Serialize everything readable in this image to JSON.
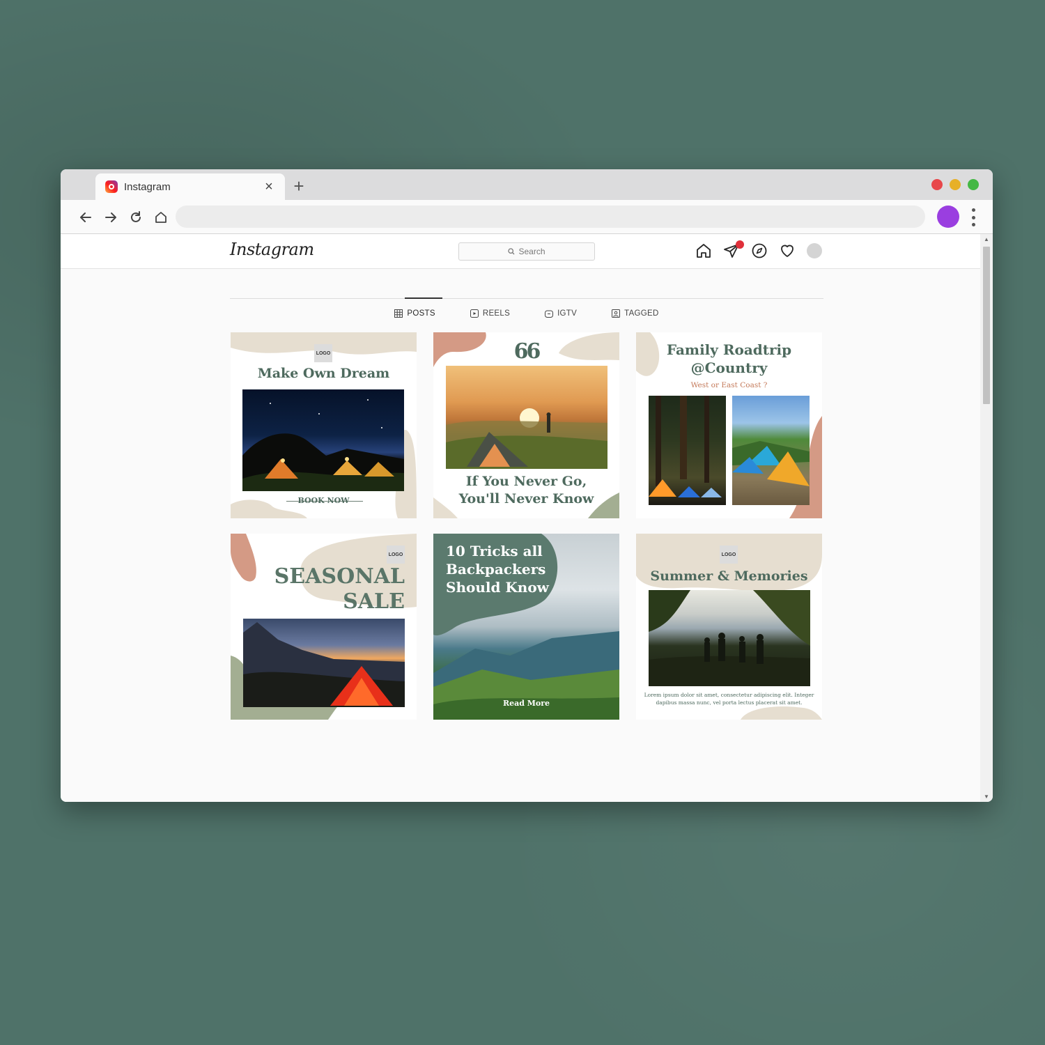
{
  "browser": {
    "tab_title": "Instagram",
    "close_glyph": "×",
    "newtab_glyph": "+",
    "traffic_lights": [
      "#e8474a",
      "#e7b027",
      "#44b844"
    ],
    "profile_color": "#9a3ee0"
  },
  "instagram": {
    "logo": "Instagram",
    "search_placeholder": "Search",
    "nav_icons": [
      "home-icon",
      "direct-icon",
      "explore-icon",
      "heart-icon",
      "avatar"
    ],
    "profile_tabs": [
      "POSTS",
      "REELS",
      "IGTV",
      "TAGGED"
    ],
    "posts": {
      "p1": {
        "logo": "LOGO",
        "title": "Make Own Dream",
        "cta": "BOOK NOW"
      },
      "p2": {
        "quote_mark": "66",
        "title_line1": "If You Never Go,",
        "title_line2": "You'll Never Know"
      },
      "p3": {
        "title_line1": "Family Roadtrip",
        "title_line2": "@Country",
        "subtitle": "West or East Coast ?"
      },
      "p4": {
        "logo": "LOGO",
        "title_line1": "SEASONAL",
        "title_line2": "SALE"
      },
      "p5": {
        "title_line1": "10 Tricks all",
        "title_line2": "Backpackers",
        "title_line3": "Should Know",
        "cta": "Read More"
      },
      "p6": {
        "logo": "LOGO",
        "title": "Summer & Memories",
        "body_line1": "Lorem ipsum dolor sit amet, consectetur adipiscing elit. Integer",
        "body_line2": "dapibus massa nunc, vel porta lectus placerat sit amet."
      }
    }
  },
  "colors": {
    "sage": "#4e6a5e",
    "beige": "#e6ded0",
    "terracotta": "#d49a85",
    "olive": "#a3ae92",
    "background": "#4f7269"
  }
}
